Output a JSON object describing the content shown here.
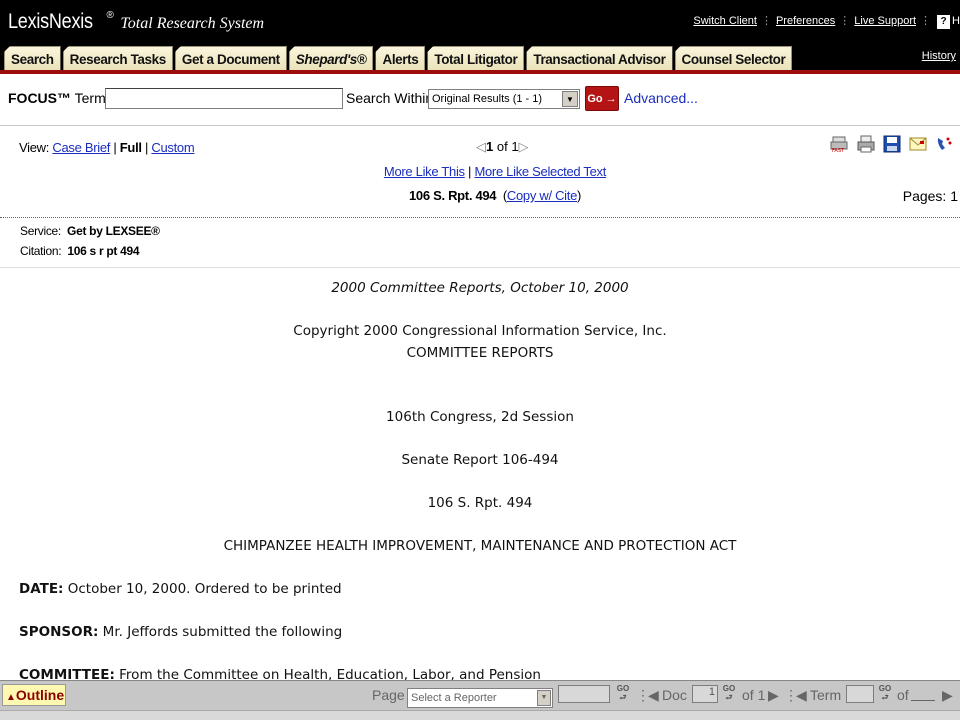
{
  "header": {
    "brand": "LexisNexis",
    "reg": "®",
    "tagline": "Total Research System",
    "links": [
      "Switch Client",
      "Preferences",
      "Live Support"
    ],
    "help_glyph": "?",
    "help_label_cut": "H",
    "history": "History"
  },
  "tabs": [
    {
      "label": "Search"
    },
    {
      "label": "Research Tasks"
    },
    {
      "label": "Get a Document"
    },
    {
      "label": "Shepard's®"
    },
    {
      "label": "Alerts"
    },
    {
      "label": "Total Litigator"
    },
    {
      "label": "Transactional Advisor"
    },
    {
      "label": "Counsel Selector"
    }
  ],
  "focus": {
    "label_bold": "FOCUS™",
    "label_rest": " Terms",
    "value": "",
    "search_within": "Search Within",
    "within_value": "Original Results (1 - 1)",
    "go": "Go →",
    "advanced": "Advanced..."
  },
  "view": {
    "label": "View:",
    "case_brief": "Case Brief",
    "full": "Full",
    "custom": "Custom",
    "pager_current": "1",
    "pager_of": "of 1",
    "more_like_this": "More Like This",
    "more_like_selected": "More Like Selected Text",
    "cite": "106 S. Rpt. 494",
    "copy_cite": "Copy w/ Cite",
    "pages_label": "Pages: 1"
  },
  "service": {
    "service_label": "Service:",
    "service_value": "Get by LEXSEE®",
    "citation_label": "Citation:",
    "citation_value": "106 s r pt 494"
  },
  "document": {
    "date_line": "2000 Committee Reports, October 10, 2000",
    "copyright": "Copyright 2000 Congressional Information Service, Inc.",
    "reports": "COMMITTEE REPORTS",
    "congress": "106th Congress, 2d Session",
    "senate_report": "Senate Report 106-494",
    "rpt": "106 S. Rpt. 494",
    "act_title": "CHIMPANZEE HEALTH IMPROVEMENT, MAINTENANCE AND PROTECTION ACT",
    "date_label": "DATE:",
    "date_value": " October 10, 2000. Ordered to be printed",
    "sponsor_label": "SPONSOR:",
    "sponsor_value": " Mr. Jeffords submitted the following",
    "committee_label": "COMMITTEE:",
    "committee_value": " From the Committee on Health, Education, Labor, and Pension"
  },
  "bottom": {
    "outline": "Outline",
    "page_label": "Page",
    "reporter_select": "Select a Reporter",
    "doc_label": "Doc",
    "doc_value": "1",
    "doc_of": "of 1",
    "term_label": "Term",
    "term_of": "of",
    "go": "GO"
  }
}
